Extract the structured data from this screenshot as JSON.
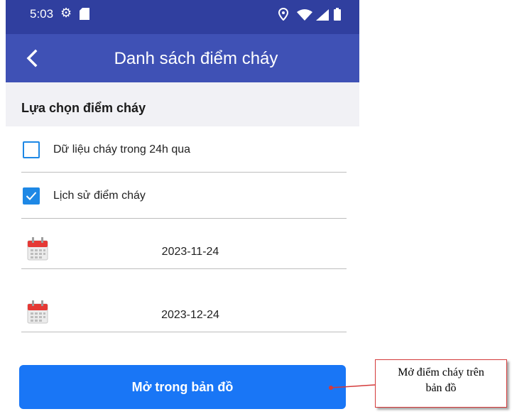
{
  "status_bar": {
    "time": "5:03",
    "icons": [
      "settings-icon",
      "sd-card-icon",
      "location-icon",
      "wifi-icon",
      "signal-icon",
      "battery-icon"
    ]
  },
  "app_bar": {
    "title": "Danh sách điểm cháy",
    "back_icon": "back-chevron-icon",
    "color": "#3f51b5",
    "status_color": "#303f9f"
  },
  "section": {
    "title": "Lựa chọn điểm cháy"
  },
  "options": [
    {
      "label": "Dữ liệu cháy trong 24h qua",
      "checked": false
    },
    {
      "label": "Lịch sử điểm cháy",
      "checked": true
    }
  ],
  "dates": {
    "from": "2023-11-24",
    "to": "2023-12-24",
    "icon": "calendar-icon"
  },
  "action": {
    "open_map_label": "Mở trong bản đồ",
    "color": "#1976f6"
  },
  "annotation": {
    "line1": "Mở điểm cháy trên",
    "line2": "bản đồ",
    "border_color": "#d43a3a"
  }
}
